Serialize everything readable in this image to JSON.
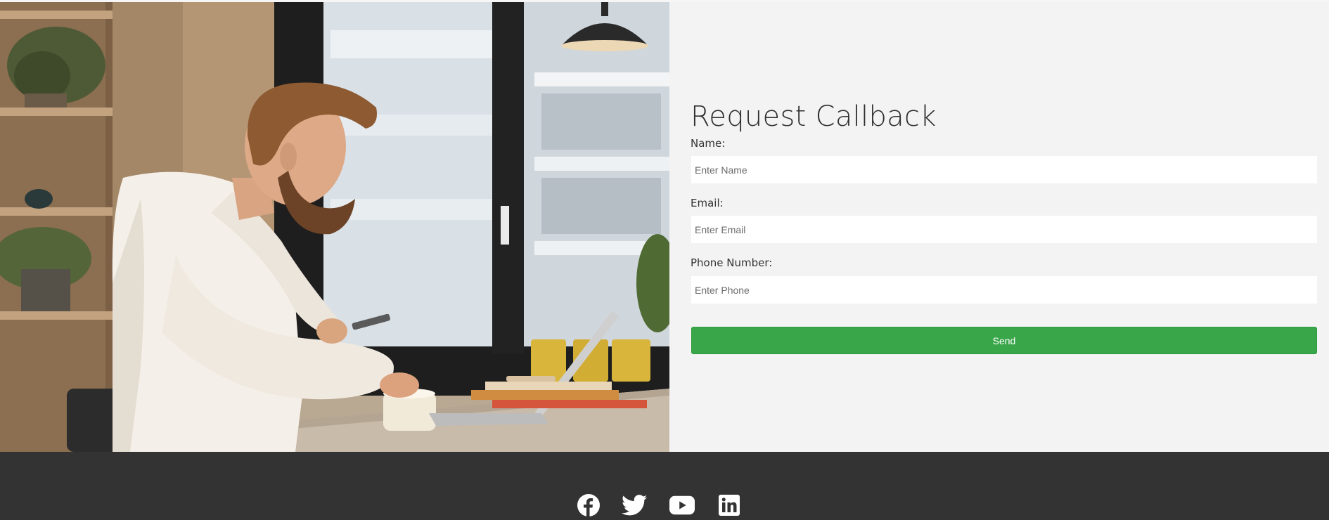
{
  "callback_form": {
    "title": "Request Callback",
    "name_label": "Name:",
    "name_placeholder": "Enter Name",
    "email_label": "Email:",
    "email_placeholder": "Enter Email",
    "phone_label": "Phone Number:",
    "phone_placeholder": "Enter Phone",
    "send_label": "Send"
  },
  "hero_image": {
    "icon": "office-worker-photo"
  },
  "footer": {
    "social_icons": [
      "facebook-icon",
      "twitter-icon",
      "youtube-icon",
      "linkedin-icon"
    ]
  },
  "colors": {
    "form_background": "#f3f3f3",
    "input_background": "#ffffff",
    "send_button": "#3aa64a",
    "footer_background": "#333333",
    "social_icon": "#ffffff"
  }
}
